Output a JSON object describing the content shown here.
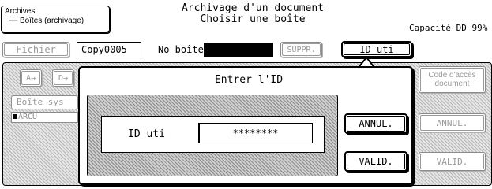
{
  "breadcrumb": {
    "root": "Archives",
    "child": "Boîtes (archivage)",
    "child_prefix": "└─"
  },
  "header": {
    "title_line1": "Archivage d'un document",
    "title_line2": "Choisir une boîte",
    "capacity": "Capacité DD 99%"
  },
  "toolbar": {
    "fichier": "Fichier",
    "document_name": "Copy0005",
    "no_boite_label": "No boîte",
    "no_boite_value": "",
    "suppr": "SUPPR.",
    "id_uti": "ID uti"
  },
  "background": {
    "sort_a": "A→",
    "sort_b": "D→",
    "boite_sys": "Boîte sys",
    "list_item": "ARCU",
    "code_acces_line1": "Code d'accès",
    "code_acces_line2": "document",
    "annul_right": "ANNUL.",
    "valid_right": "VALID."
  },
  "dialog": {
    "title": "Entrer l'ID",
    "id_label": "ID uti",
    "id_value": "********",
    "annul": "ANNUL.",
    "valid": "VALID."
  }
}
